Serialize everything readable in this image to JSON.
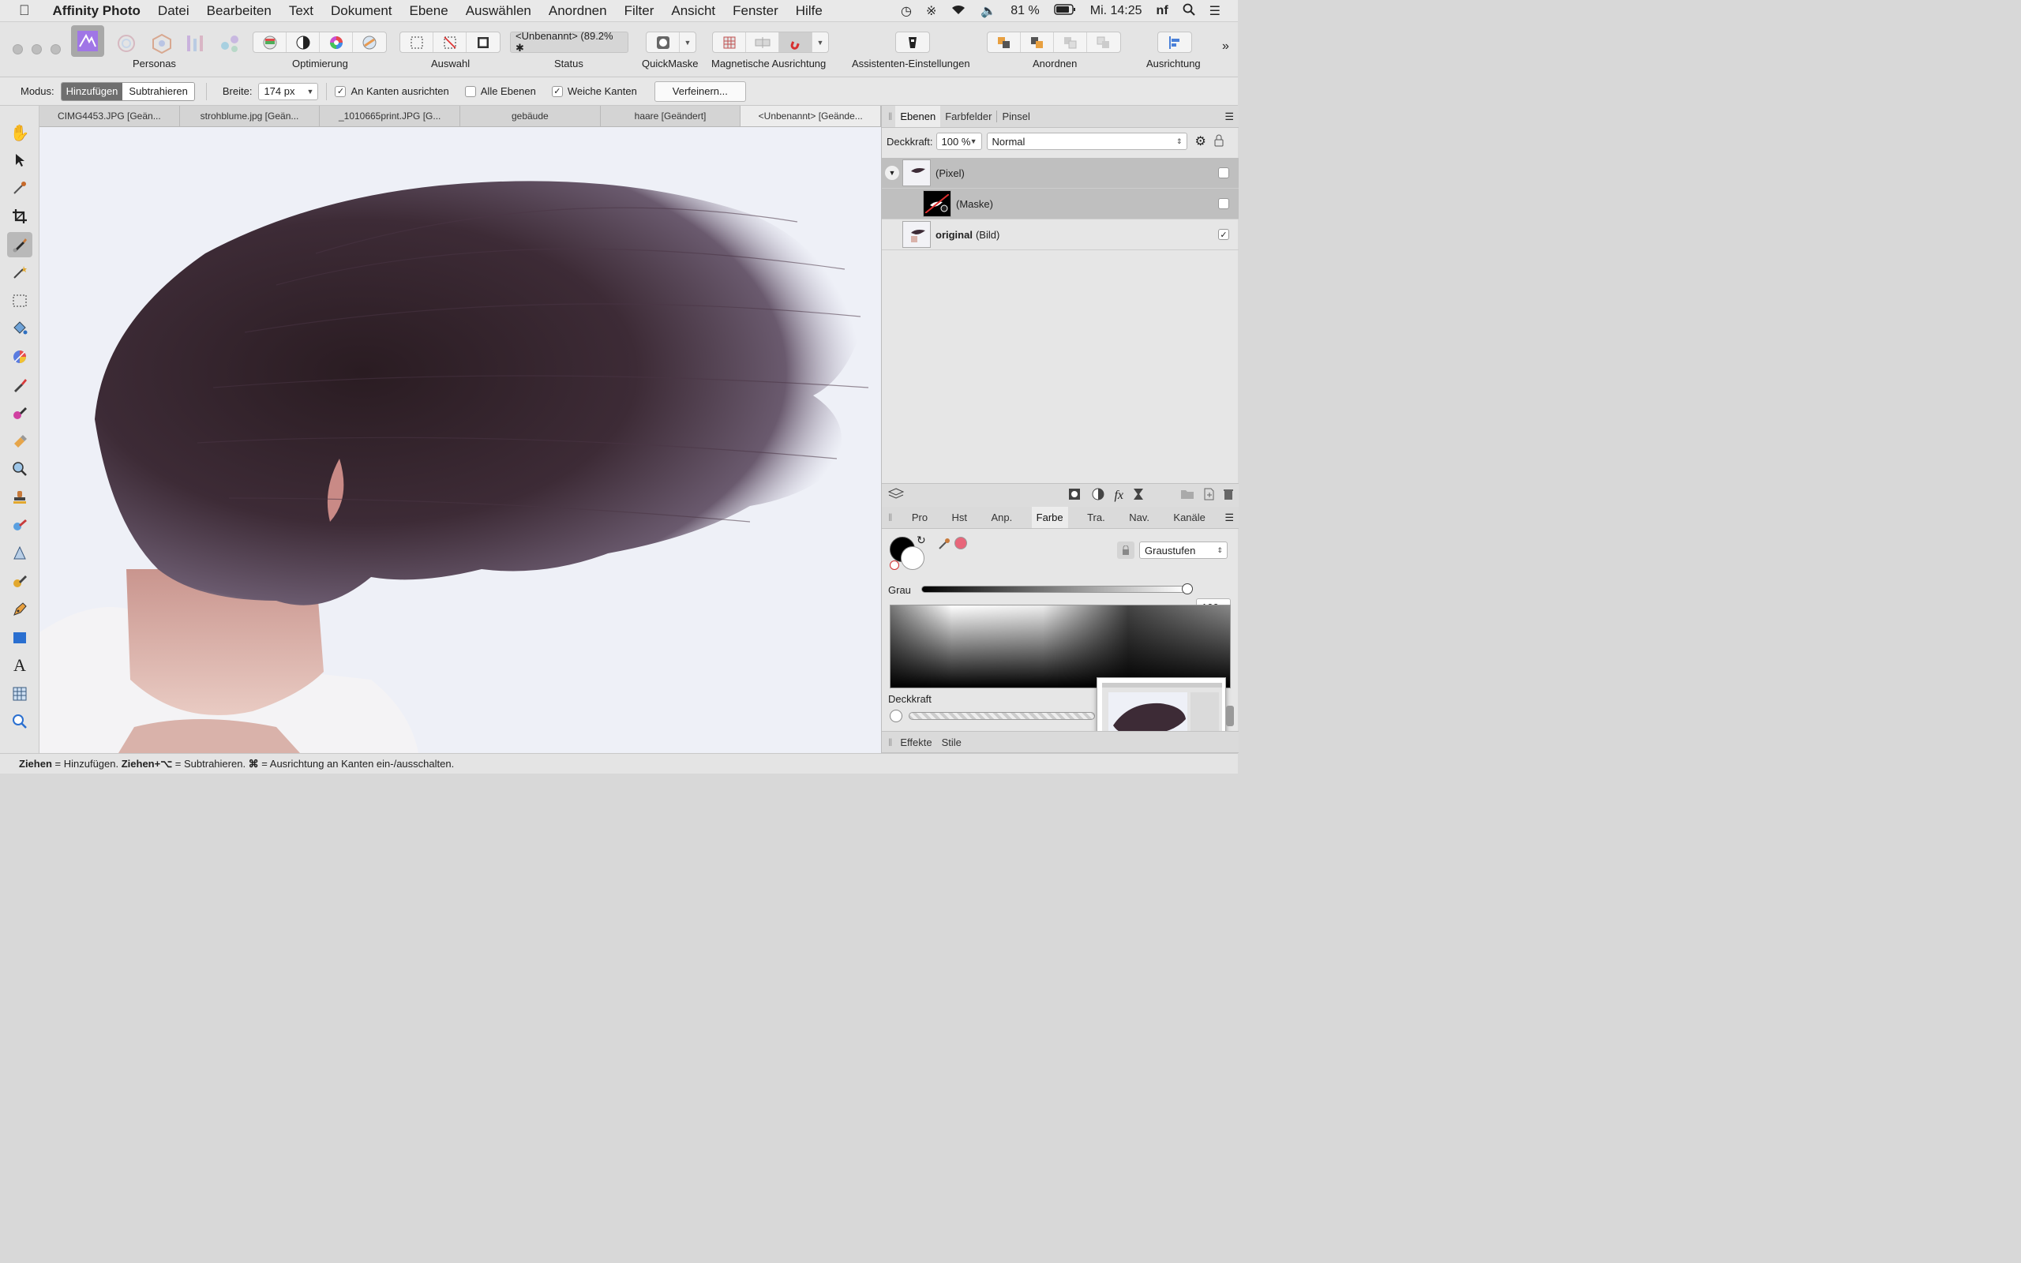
{
  "menubar": {
    "app_name": "Affinity Photo",
    "items": [
      "Datei",
      "Bearbeiten",
      "Text",
      "Dokument",
      "Ebene",
      "Auswählen",
      "Anordnen",
      "Filter",
      "Ansicht",
      "Fenster",
      "Hilfe"
    ],
    "battery": "81 %",
    "clock": "Mi. 14:25",
    "user": "nf"
  },
  "toolbar": {
    "personas_label": "Personas",
    "optimierung_label": "Optimierung",
    "auswahl_label": "Auswahl",
    "status_value": "<Unbenannt> (89.2% ✱",
    "status_label": "Status",
    "quickmask_label": "QuickMaske",
    "snapping_label": "Magnetische Ausrichtung",
    "assistant_label": "Assistenten-Einstellungen",
    "arrange_label": "Anordnen",
    "align_label": "Ausrichtung"
  },
  "context": {
    "mode_label": "Modus:",
    "add_label": "Hinzufügen",
    "subtract_label": "Subtrahieren",
    "width_label": "Breite:",
    "width_value": "174 px",
    "snap_edges_label": "An Kanten ausrichten",
    "all_layers_label": "Alle Ebenen",
    "soft_edges_label": "Weiche Kanten",
    "refine_label": "Verfeinern..."
  },
  "tabs": [
    "CIMG4453.JPG [Geän...",
    "strohblume.jpg [Geän...",
    "_1010665print.JPG [G...",
    "gebäude",
    "haare [Geändert]",
    "<Unbenannt> [Geände..."
  ],
  "layers_panel": {
    "tabs": [
      "Ebenen",
      "Farbfelder",
      "Pinsel"
    ],
    "opacity_label": "Deckkraft:",
    "opacity_value": "100 %",
    "blend_mode": "Normal",
    "layers": [
      {
        "name": "(Pixel)",
        "bold": "",
        "visible": false
      },
      {
        "name": "(Maske)",
        "bold": "",
        "visible": false
      },
      {
        "name": "(Bild)",
        "bold": "original",
        "visible": true
      }
    ]
  },
  "color_panel": {
    "tabs": [
      "Pro",
      "Hst",
      "Anp.",
      "Farbe",
      "Tra.",
      "Nav.",
      "Kanäle"
    ],
    "model": "Graustufen",
    "gray_label": "Grau",
    "gray_value": "100",
    "opacity_label": "Deckkraft"
  },
  "effects_panel": {
    "tabs": [
      "Effekte",
      "Stile"
    ]
  },
  "status_bar": {
    "k1": "Ziehen",
    "t1": " = Hinzufügen. ",
    "k2": "Ziehen+⌥",
    "t2": " = Subtrahieren. ",
    "k3": "⌘",
    "t3": " = Ausrichtung an Kanten ein-/ausschalten."
  },
  "colors": {
    "accent": "#8e5fd6",
    "active_toggle": "#6f6f6f",
    "swatch_pink": "#e8667a"
  }
}
